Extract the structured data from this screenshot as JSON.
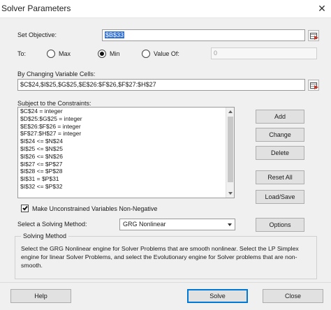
{
  "window": {
    "title": "Solver Parameters",
    "close_glyph": "✕"
  },
  "objective": {
    "label": "Set Objective:",
    "value": "$B$33"
  },
  "to": {
    "label": "To:",
    "options": [
      {
        "label": "Max",
        "checked": false
      },
      {
        "label": "Min",
        "checked": true
      },
      {
        "label": "Value Of:",
        "checked": false
      }
    ],
    "value_of": "0"
  },
  "variables": {
    "label": "By Changing Variable Cells:",
    "value": "$C$24,$I$25,$G$25,$E$26:$F$26,$F$27:$H$27"
  },
  "constraints": {
    "label": "Subject to the Constraints:",
    "items": [
      "$C$24 = integer",
      "$D$25:$G$25 = integer",
      "$E$26:$F$26 = integer",
      "$F$27:$H$27 = integer",
      "$I$24 <= $N$24",
      "$I$25 <= $N$25",
      "$I$26 <= $N$26",
      "$I$27 <= $P$27",
      "$I$28 <= $P$28",
      "$I$31 = $P$31",
      "$I$32 <= $P$32"
    ]
  },
  "side_buttons": {
    "add": "Add",
    "change": "Change",
    "delete": "Delete",
    "reset": "Reset All",
    "load_save": "Load/Save"
  },
  "unconstrained": {
    "label": "Make Unconstrained Variables Non-Negative",
    "checked": true
  },
  "method": {
    "label": "Select a Solving Method:",
    "value": "GRG Nonlinear",
    "options_button": "Options"
  },
  "solving_method": {
    "legend": "Solving Method",
    "description": "Select the GRG Nonlinear engine for Solver Problems that are smooth nonlinear. Select the LP Simplex engine for linear Solver Problems, and select the Evolutionary engine for Solver problems that are non-smooth."
  },
  "footer": {
    "help": "Help",
    "solve": "Solve",
    "close": "Close"
  },
  "colors": {
    "dialog_bg": "#f0f0f0",
    "primary_border": "#0078d7",
    "selection": "#2f6fd1"
  }
}
